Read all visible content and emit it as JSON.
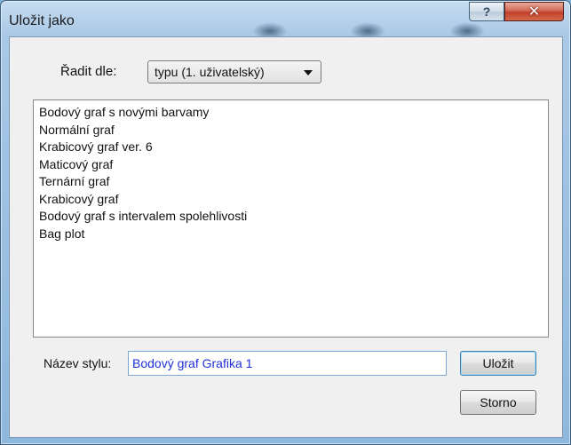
{
  "window": {
    "title": "Uložit jako",
    "help_label": "?",
    "close_label": "✕"
  },
  "sort": {
    "label": "Řadit dle:",
    "selected": "typu (1. uživatelský)"
  },
  "styles": {
    "items": [
      "Bodový graf s novými barvamy",
      "Normální graf",
      "Krabicový graf ver. 6",
      "Maticový graf",
      "Ternární graf",
      "Krabicový graf",
      "Bodový graf s intervalem spolehlivosti",
      "Bag plot"
    ]
  },
  "name_field": {
    "label": "Název stylu:",
    "value": "Bodový graf Grafika 1"
  },
  "buttons": {
    "save": "Uložit",
    "cancel": "Storno"
  }
}
